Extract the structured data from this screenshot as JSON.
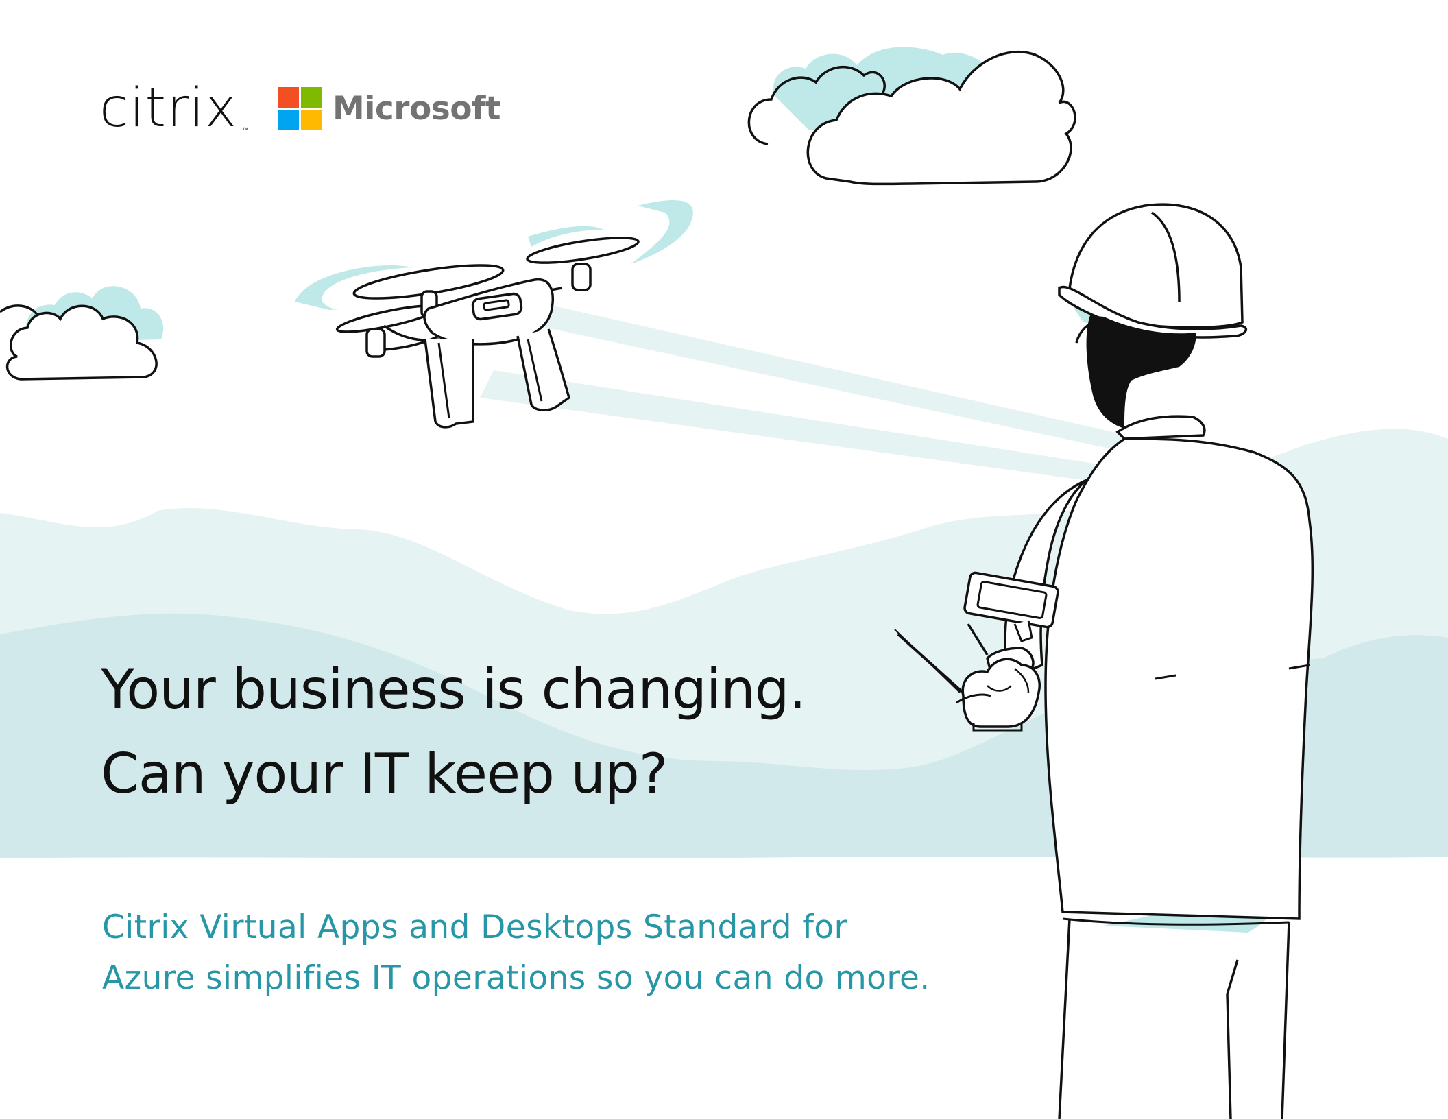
{
  "logos": {
    "citrix": {
      "wordmark": "citrix",
      "trademark": "™"
    },
    "microsoft": {
      "wordmark": "Microsoft",
      "square_colors": [
        "#f25022",
        "#7fba00",
        "#00a4ef",
        "#ffb900"
      ]
    }
  },
  "headline": {
    "line1": "Your business is changing.",
    "line2": "Can your IT keep up?"
  },
  "subheadline": {
    "line1": "Citrix Virtual Apps and Desktops Standard for",
    "line2": "Azure simplifies IT operations so you can do more."
  },
  "colors": {
    "headline_text": "#111111",
    "subheadline_text": "#2796a6",
    "accent_teal": "#bfe9e8",
    "hill_far": "#e6f3f3",
    "hill_near": "#d2e9eb"
  },
  "illustration": {
    "icons": [
      "cloud-icon",
      "drone-icon",
      "worker-with-hardhat-icon",
      "remote-controller-icon"
    ]
  }
}
